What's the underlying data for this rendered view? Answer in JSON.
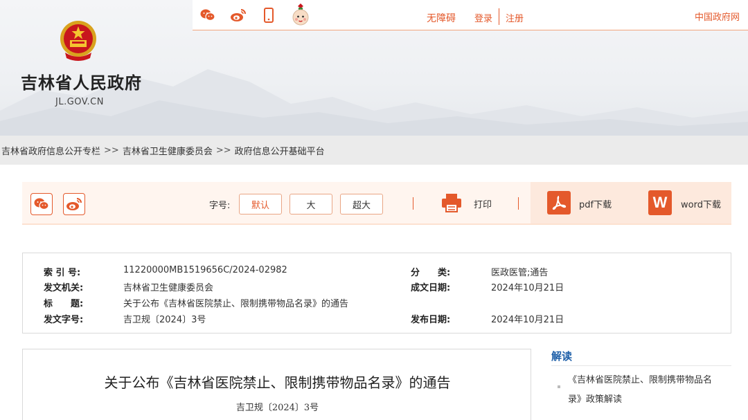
{
  "header": {
    "site_name": "吉林省人民政府",
    "site_domain": "JL.GOV.CN",
    "accessibility": "无障碍",
    "login": "登录",
    "register": "注册",
    "gov_link": "中国政府网",
    "icons": [
      "wechat-icon",
      "weibo-icon",
      "mobile-icon",
      "mascot-icon"
    ]
  },
  "breadcrumb": {
    "items": [
      "吉林省政府信息公开专栏",
      "吉林省卫生健康委员会",
      "政府信息公开基础平台"
    ],
    "separator": ">>"
  },
  "toolbar": {
    "font_label": "字号:",
    "font_sizes": [
      "默认",
      "大",
      "超大"
    ],
    "print": "打印",
    "pdf": "pdf下载",
    "word": "word下载",
    "word_icon_letter": "W"
  },
  "meta": {
    "index_label": "索 引 号:",
    "index_value": "11220000MB1519656C/2024-02982",
    "category_label": "分　　类:",
    "category_value": "医政医管;通告",
    "issuer_label": "发文机关:",
    "issuer_value": "吉林省卫生健康委员会",
    "created_label": "成文日期:",
    "created_value": "2024年10月21日",
    "title_label": "标　　题:",
    "title_value": "关于公布《吉林省医院禁止、限制携带物品名录》的通告",
    "docno_label": "发文字号:",
    "docno_value": "吉卫规〔2024〕3号",
    "published_label": "发布日期:",
    "published_value": "2024年10月21日"
  },
  "article": {
    "title": "关于公布《吉林省医院禁止、限制携带物品名录》的通告",
    "doc_number": "吉卫规〔2024〕3号"
  },
  "sidebar": {
    "title": "解读",
    "link": "《吉林省医院禁止、限制携带物品名录》政策解读"
  },
  "colors": {
    "accent": "#e4592b",
    "link_blue": "#1e5fa8"
  }
}
